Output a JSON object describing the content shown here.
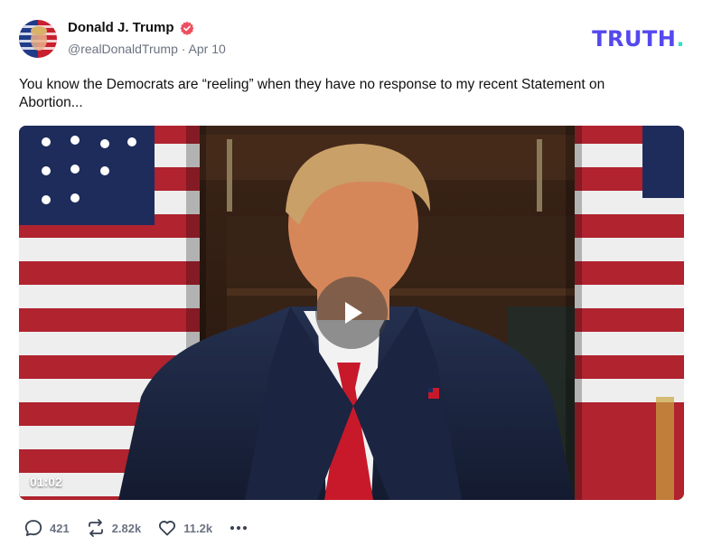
{
  "post": {
    "author_name": "Donald J. Trump",
    "handle": "@realDonaldTrump",
    "separator": "·",
    "date": "Apr 10",
    "text": "You know the Democrats are “reeling” when they have no response to my recent Statement on Abortion..."
  },
  "brand": {
    "name": "TRUTH",
    "dot": "."
  },
  "video": {
    "duration": "01:02",
    "play_icon": "play-icon"
  },
  "actions": {
    "replies": "421",
    "retruths": "2.82k",
    "likes": "11.2k"
  },
  "colors": {
    "brand": "#5448ee",
    "brand_dot": "#36e0c5",
    "verified": "#ee4f5f",
    "muted": "#6b7280"
  }
}
